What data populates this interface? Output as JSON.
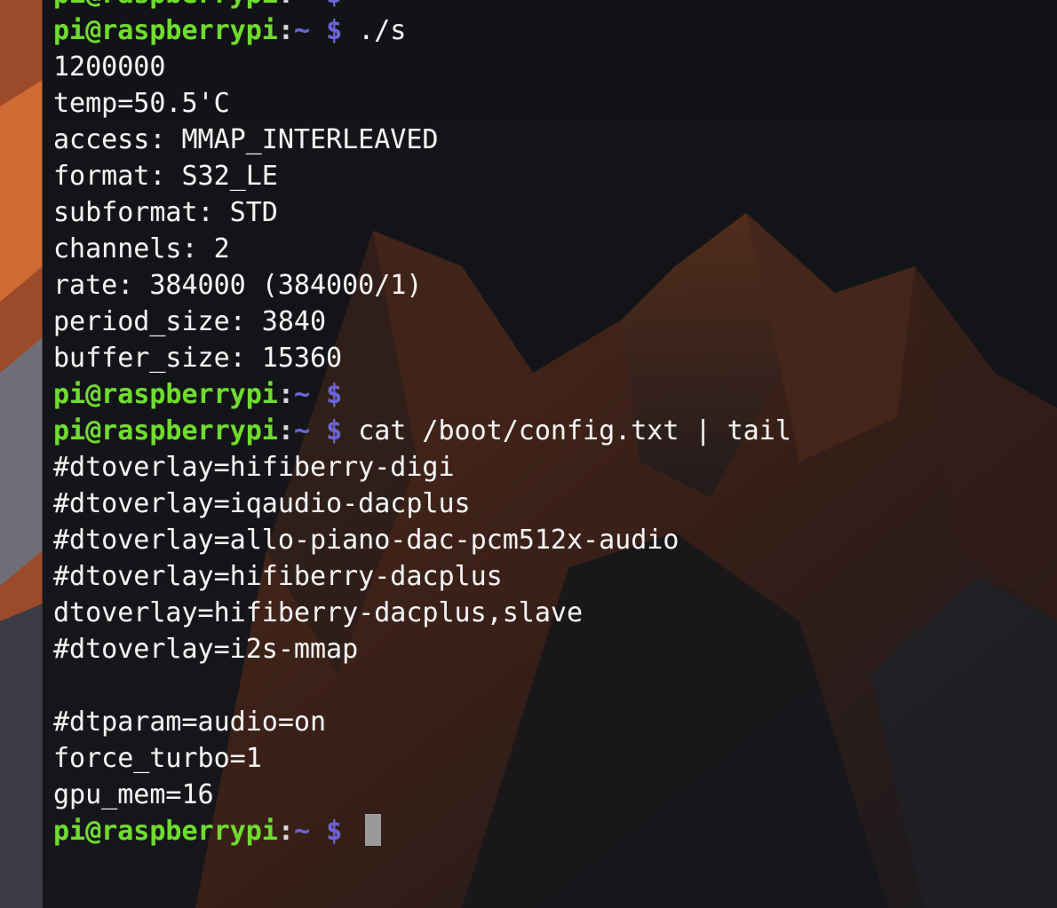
{
  "terminal": {
    "prompt": {
      "user_host": "pi@raspberrypi",
      "separator": ":",
      "path": "~",
      "symbol": "$"
    },
    "lines": [
      {
        "type": "prompt",
        "command": ""
      },
      {
        "type": "prompt",
        "command": "./s"
      },
      {
        "type": "output",
        "text": "1200000"
      },
      {
        "type": "output",
        "text": "temp=50.5'C"
      },
      {
        "type": "output",
        "text": "access: MMAP_INTERLEAVED"
      },
      {
        "type": "output",
        "text": "format: S32_LE"
      },
      {
        "type": "output",
        "text": "subformat: STD"
      },
      {
        "type": "output",
        "text": "channels: 2"
      },
      {
        "type": "output",
        "text": "rate: 384000 (384000/1)"
      },
      {
        "type": "output",
        "text": "period_size: 3840"
      },
      {
        "type": "output",
        "text": "buffer_size: 15360"
      },
      {
        "type": "prompt",
        "command": ""
      },
      {
        "type": "prompt",
        "command": "cat /boot/config.txt | tail"
      },
      {
        "type": "output",
        "text": "#dtoverlay=hifiberry-digi"
      },
      {
        "type": "output",
        "text": "#dtoverlay=iqaudio-dacplus"
      },
      {
        "type": "output",
        "text": "#dtoverlay=allo-piano-dac-pcm512x-audio"
      },
      {
        "type": "output",
        "text": "#dtoverlay=hifiberry-dacplus"
      },
      {
        "type": "output",
        "text": "dtoverlay=hifiberry-dacplus,slave"
      },
      {
        "type": "output",
        "text": "#dtoverlay=i2s-mmap"
      },
      {
        "type": "output",
        "text": ""
      },
      {
        "type": "output",
        "text": "#dtparam=audio=on"
      },
      {
        "type": "output",
        "text": "force_turbo=1"
      },
      {
        "type": "output",
        "text": "gpu_mem=16"
      },
      {
        "type": "prompt",
        "command": "",
        "cursor": true
      }
    ]
  },
  "colors": {
    "prompt_user": "#6fdc2e",
    "prompt_symbol": "#6b63d6",
    "output_text": "#f2f2f2",
    "terminal_background": "#0c0e11"
  }
}
